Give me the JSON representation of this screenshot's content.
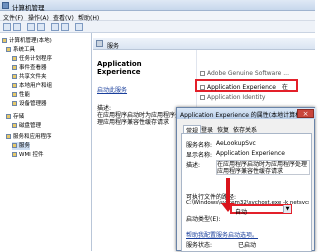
{
  "window": {
    "title": "计算机管理"
  },
  "menu": [
    "文件(F)",
    "操作(A)",
    "查看(V)",
    "帮助(H)"
  ],
  "tree": [
    {
      "label": "计算机管理(本地)",
      "indent": 0
    },
    {
      "label": "系统工具",
      "indent": 1
    },
    {
      "label": "任务计划程序",
      "indent": 2
    },
    {
      "label": "事件查看器",
      "indent": 2
    },
    {
      "label": "共享文件夹",
      "indent": 2
    },
    {
      "label": "本地用户和组",
      "indent": 2
    },
    {
      "label": "性能",
      "indent": 2
    },
    {
      "label": "设备管理器",
      "indent": 2
    },
    {
      "label": "存储",
      "indent": 1
    },
    {
      "label": "磁盘管理",
      "indent": 2
    },
    {
      "label": "服务和应用程序",
      "indent": 1
    },
    {
      "label": "服务",
      "indent": 2
    },
    {
      "label": "WMI 控件",
      "indent": 2
    }
  ],
  "main": {
    "header": "服务",
    "selected_title": "Application Experience",
    "stop_link": "启动此服务",
    "desc_label": "描述:",
    "desc_text": "在应用程序启动时为应用程序处理应用程序兼容性缓存请求"
  },
  "services": [
    {
      "name": "Adobe Genuine Software ..."
    },
    {
      "name": "Application Experience",
      "tail": "在"
    },
    {
      "name": "Application Identity"
    }
  ],
  "dialog": {
    "title": "Application Experience 的属性(本地计算机)",
    "close": "×",
    "tabs": [
      "常规",
      "登录",
      "恢复",
      "依存关系"
    ],
    "service_name_label": "服务名称:",
    "service_name": "AeLookupSvc",
    "display_name_label": "显示名称:",
    "display_name": "Application Experience",
    "description_label": "描述:",
    "description": "在应用程序启动时为应用程序处理应用程序兼容性缓存请求",
    "exe_path_label": "可执行文件的路径:",
    "exe_path": "C:\\Windows\\system32\\svchost.exe -k netsvcs",
    "startup_label": "启动类型(E):",
    "startup_value": "自动",
    "help_link": "帮助我配置服务启动选项。",
    "status_label": "服务状态:",
    "status_value": "已启动"
  }
}
